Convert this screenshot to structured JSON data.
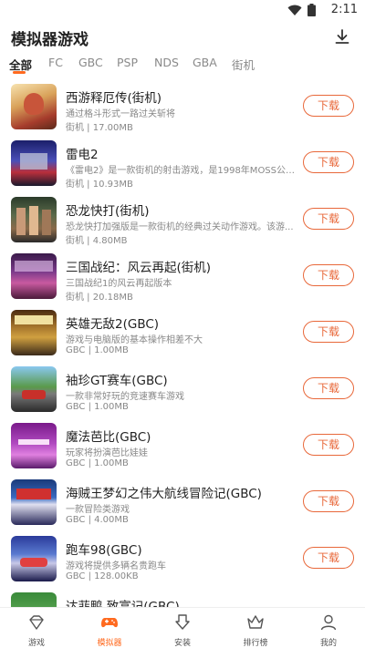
{
  "status": {
    "time": "2:11",
    "icons": [
      "wifi-icon",
      "battery-icon"
    ]
  },
  "header": {
    "title": "模拟器游戏",
    "download_icon": "download-icon"
  },
  "tabs": [
    {
      "label": "全部",
      "active": true
    },
    {
      "label": "FC"
    },
    {
      "label": "GBC"
    },
    {
      "label": "PSP"
    },
    {
      "label": "NDS"
    },
    {
      "label": "GBA"
    },
    {
      "label": "街机"
    }
  ],
  "games": [
    {
      "name": "西游释厄传(街机)",
      "desc": "通过格斗形式一路过关斩将",
      "meta": "街机 | 17.00MB",
      "button": "下载"
    },
    {
      "name": "雷电2",
      "desc": "《雷电2》是一款街机的射击游戏，是1998年MOSS公司...",
      "meta": "街机 | 10.93MB",
      "button": "下载"
    },
    {
      "name": "恐龙快打(街机)",
      "desc": "恐龙快打加强版是一款街机的经典过关动作游戏。该游...",
      "meta": "街机 | 4.80MB",
      "button": "下载"
    },
    {
      "name": "三国战纪：风云再起(街机)",
      "desc": "三国战纪1的风云再起版本",
      "meta": "街机 | 20.18MB",
      "button": "下载"
    },
    {
      "name": "英雄无敌2(GBC)",
      "desc": "游戏与电脑版的基本操作相差不大",
      "meta": "GBC | 1.00MB",
      "button": "下载"
    },
    {
      "name": "袖珍GT赛车(GBC)",
      "desc": "一款非常好玩的竞速赛车游戏",
      "meta": "GBC | 1.00MB",
      "button": "下载"
    },
    {
      "name": "魔法芭比(GBC)",
      "desc": "玩家将扮演芭比娃娃",
      "meta": "GBC | 1.00MB",
      "button": "下载"
    },
    {
      "name": "海贼王梦幻之伟大航线冒险记(GBC)",
      "desc": "一款冒险类游戏",
      "meta": "GBC | 4.00MB",
      "button": "下载"
    },
    {
      "name": "跑车98(GBC)",
      "desc": "游戏将提供多辆名贵跑车",
      "meta": "GBC | 128.00KB",
      "button": "下载"
    },
    {
      "name": "达菲鸭 致富记(GBC)",
      "desc": "",
      "meta": "",
      "button": ""
    }
  ],
  "bottom_nav": [
    {
      "label": "游戏",
      "icon": "diamond-icon",
      "active": false
    },
    {
      "label": "模拟器",
      "icon": "gamepad-icon",
      "active": true
    },
    {
      "label": "安装",
      "icon": "install-icon",
      "active": false
    },
    {
      "label": "排行榜",
      "icon": "crown-icon",
      "active": false
    },
    {
      "label": "我的",
      "icon": "user-icon",
      "active": false
    }
  ],
  "colors": {
    "accent": "#ff6a1f",
    "button_border": "#e8683a"
  }
}
